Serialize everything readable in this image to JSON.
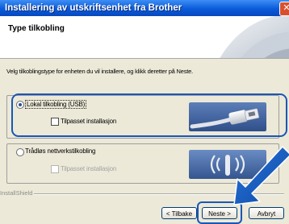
{
  "window": {
    "title": "Installering av utskriftsenhet fra Brother"
  },
  "header": {
    "title": "Type tilkobling"
  },
  "instruction": "Velg tilkoblingstype for enheten du vil installere, og klikk deretter på Neste.",
  "options": {
    "usb": {
      "label": "Lokal tilkobling (USB)",
      "selected": true,
      "custom_install_label": "Tilpasset installasjon",
      "custom_install_checked": false,
      "custom_install_enabled": true,
      "icon": "usb-plug-icon"
    },
    "wireless": {
      "label": "Trådløs nettverkstilkobling",
      "selected": false,
      "custom_install_label": "Tilpasset installasjon",
      "custom_install_checked": false,
      "custom_install_enabled": false,
      "icon": "wireless-signal-icon"
    }
  },
  "footer": {
    "brand": "InstallShield"
  },
  "buttons": {
    "back": "< Tilbake",
    "next": "Neste >",
    "cancel": "Avbryt"
  },
  "colors": {
    "highlight": "#1a56b8",
    "titlebar": "#0a5bd9"
  }
}
